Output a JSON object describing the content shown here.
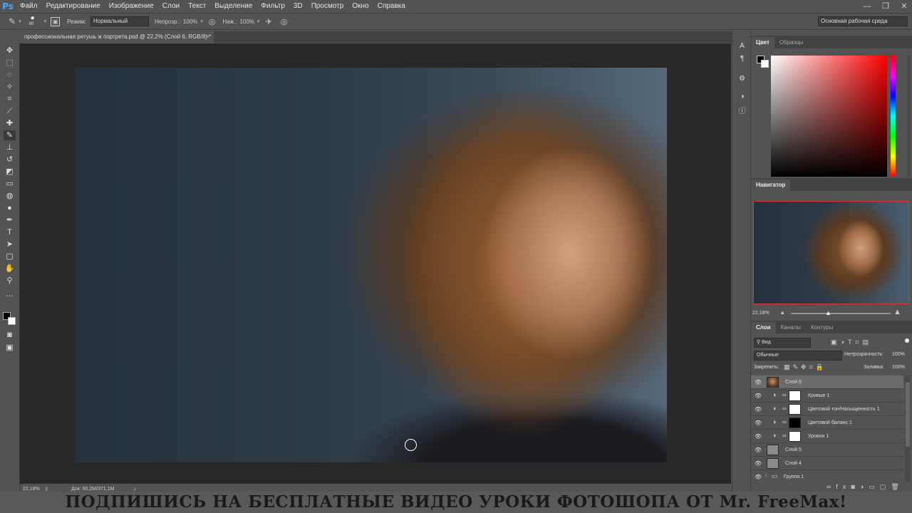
{
  "app": {
    "logo": "Ps"
  },
  "menu": [
    "Файл",
    "Редактирование",
    "Изображение",
    "Слои",
    "Текст",
    "Выделение",
    "Фильтр",
    "3D",
    "Просмотр",
    "Окно",
    "Справка"
  ],
  "window_controls": {
    "minimize": "—",
    "restore": "❐",
    "close": "✕"
  },
  "options": {
    "brush_size": "80",
    "mode_label": "Режим:",
    "mode_value": "Нормальный",
    "opacity_label": "Непрозр.:",
    "opacity_value": "100%",
    "flow_label": "Наж.:",
    "flow_value": "100%",
    "workspace": "Основная рабочая среда"
  },
  "document": {
    "tab_title": "профессиональная ретушь ж портрета.psd @ 22,2% (Слой 6, RGB/8) *",
    "close": "×"
  },
  "status": {
    "zoom": "22,18%",
    "doc": "Док: 60,2M/371,1M"
  },
  "color_panel": {
    "tabs": [
      "Цвет",
      "Образцы"
    ]
  },
  "navigator": {
    "title": "Навигатор",
    "zoom": "22,18%"
  },
  "layers_panel": {
    "tabs": [
      "Слои",
      "Каналы",
      "Контуры"
    ],
    "filter_label": "Вид",
    "blend_mode": "Обычные",
    "opacity_label": "Непрозрачность:",
    "opacity_value": "100%",
    "lock_label": "Закрепить:",
    "fill_label": "Заливка:",
    "fill_value": "100%",
    "layers": [
      {
        "name": "Слой 6"
      },
      {
        "name": "Кривые 1"
      },
      {
        "name": "Цветовой тон/Насыщенность 1"
      },
      {
        "name": "Цветовой баланс 1"
      },
      {
        "name": "Уровни 1"
      },
      {
        "name": "Слой 5"
      },
      {
        "name": "Слой 4"
      },
      {
        "name": "Группа 1"
      }
    ],
    "footer_icons": [
      "link-icon",
      "fx-icon",
      "mask-icon",
      "adjustment-icon",
      "folder-icon",
      "new-layer-icon",
      "trash-icon"
    ]
  },
  "banner": "ПОДПИШИСЬ НА БЕСПЛАТНЫЕ ВИДЕО УРОКИ ФОТОШОПА ОТ Mr. FreeMax!"
}
